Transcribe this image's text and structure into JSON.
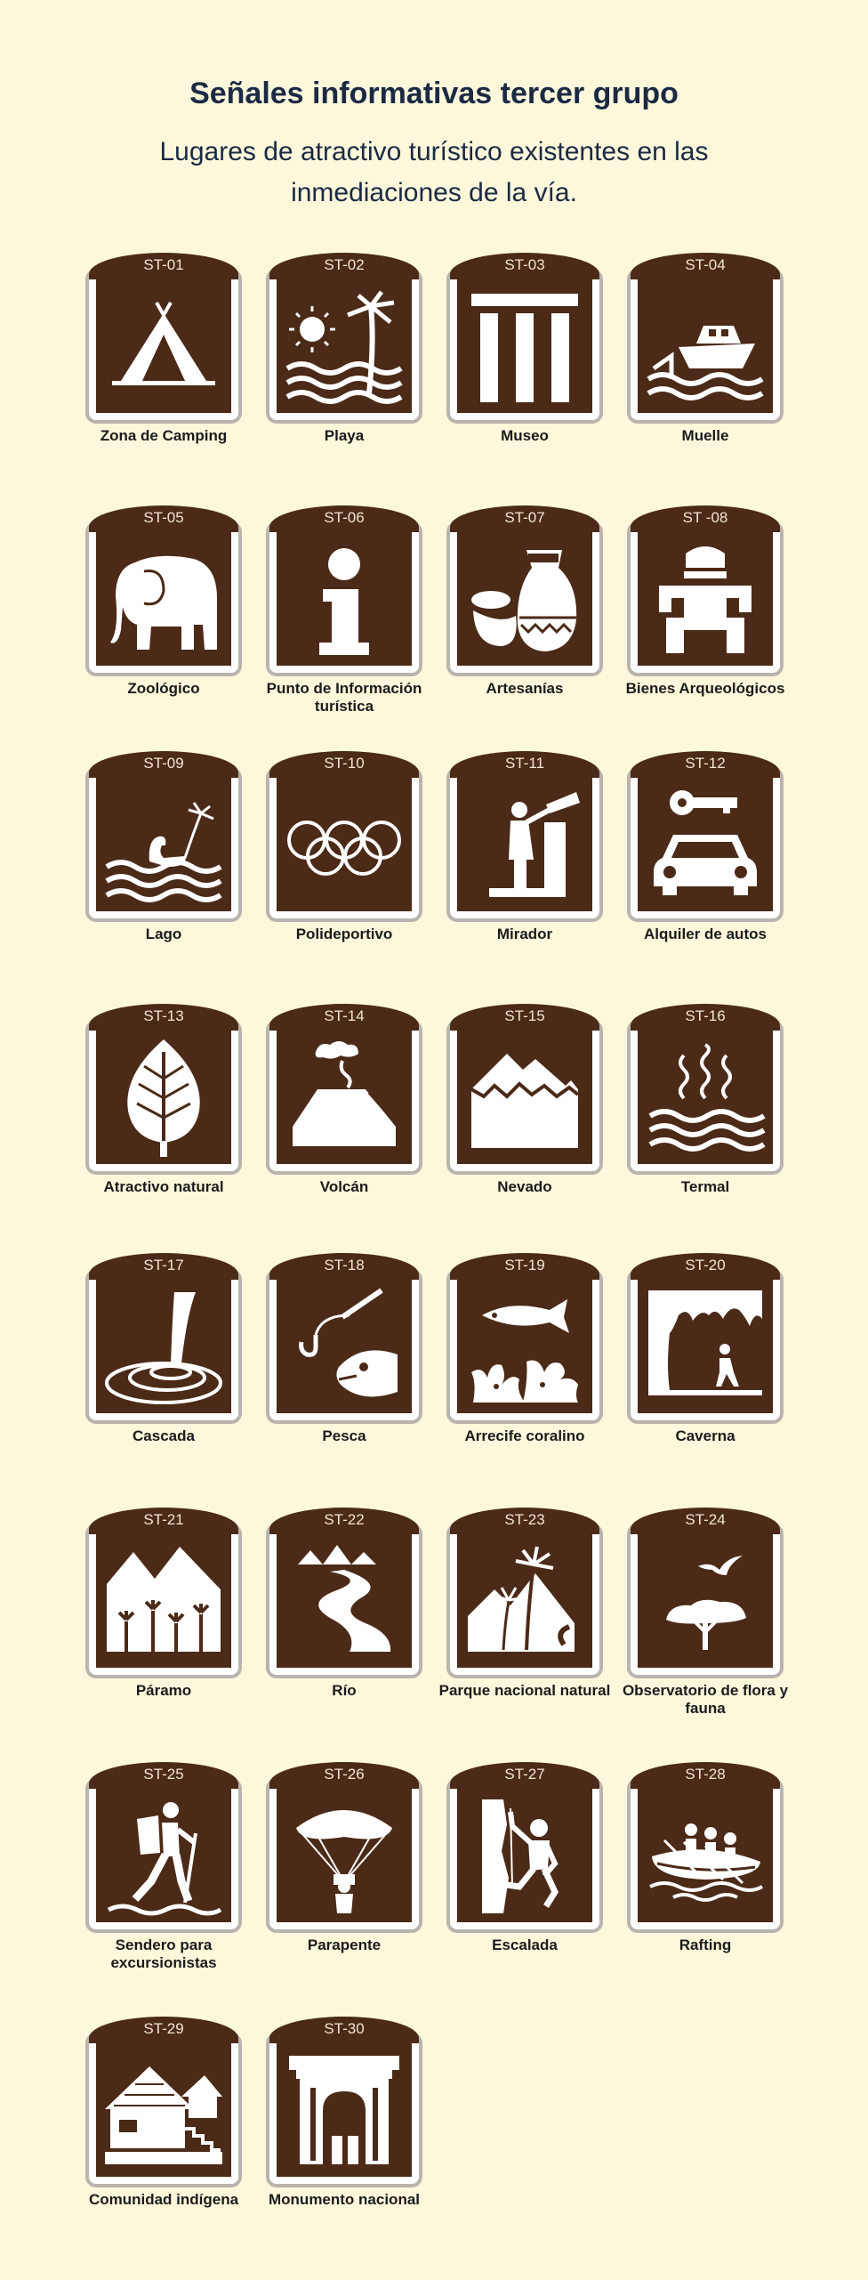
{
  "title": "Señales informativas tercer grupo",
  "subtitle": "Lugares de atractivo turístico existentes en las inmediaciones de la vía.",
  "colors": {
    "background": "#fdf8dc",
    "sign": "#4b2a17",
    "frame": "#b9b4ae"
  },
  "signs": [
    {
      "code": "ST-01",
      "label": "Zona de Camping",
      "icon": "tent-icon"
    },
    {
      "code": "ST-02",
      "label": "Playa",
      "icon": "beach-icon"
    },
    {
      "code": "ST-03",
      "label": "Museo",
      "icon": "museum-icon"
    },
    {
      "code": "ST-04",
      "label": "Muelle",
      "icon": "dock-icon"
    },
    {
      "code": "ST-05",
      "label": "Zoológico",
      "icon": "elephant-icon"
    },
    {
      "code": "ST-06",
      "label": "Punto de Información turística",
      "icon": "info-icon"
    },
    {
      "code": "ST-07",
      "label": "Artesanías",
      "icon": "pottery-icon"
    },
    {
      "code": "ST -08",
      "label": "Bienes Arqueológicos",
      "icon": "archaeology-icon"
    },
    {
      "code": "ST-09",
      "label": "Lago",
      "icon": "lake-icon"
    },
    {
      "code": "ST-10",
      "label": "Polideportivo",
      "icon": "olympic-rings-icon"
    },
    {
      "code": "ST-11",
      "label": "Mirador",
      "icon": "viewpoint-icon"
    },
    {
      "code": "ST-12",
      "label": "Alquiler de autos",
      "icon": "car-rental-icon"
    },
    {
      "code": "ST-13",
      "label": "Atractivo natural",
      "icon": "leaf-icon"
    },
    {
      "code": "ST-14",
      "label": "Volcán",
      "icon": "volcano-icon"
    },
    {
      "code": "ST-15",
      "label": "Nevado",
      "icon": "snowy-mountain-icon"
    },
    {
      "code": "ST-16",
      "label": "Termal",
      "icon": "hot-spring-icon"
    },
    {
      "code": "ST-17",
      "label": "Cascada",
      "icon": "waterfall-icon"
    },
    {
      "code": "ST-18",
      "label": "Pesca",
      "icon": "fishing-icon"
    },
    {
      "code": "ST-19",
      "label": "Arrecife coralino",
      "icon": "coral-reef-icon"
    },
    {
      "code": "ST-20",
      "label": "Caverna",
      "icon": "cave-icon"
    },
    {
      "code": "ST-21",
      "label": "Páramo",
      "icon": "moorland-icon"
    },
    {
      "code": "ST-22",
      "label": "Río",
      "icon": "river-icon"
    },
    {
      "code": "ST-23",
      "label": "Parque nacional natural",
      "icon": "national-park-icon"
    },
    {
      "code": "ST-24",
      "label": "Observatorio de flora y fauna",
      "icon": "wildlife-observatory-icon"
    },
    {
      "code": "ST-25",
      "label": "Sendero para excursionistas",
      "icon": "hiker-icon"
    },
    {
      "code": "ST-26",
      "label": "Parapente",
      "icon": "paraglider-icon"
    },
    {
      "code": "ST-27",
      "label": "Escalada",
      "icon": "climbing-icon"
    },
    {
      "code": "ST-28",
      "label": "Rafting",
      "icon": "rafting-icon"
    },
    {
      "code": "ST-29",
      "label": "Comunidad indígena",
      "icon": "indigenous-community-icon"
    },
    {
      "code": "ST-30",
      "label": "Monumento nacional",
      "icon": "monument-icon"
    }
  ]
}
